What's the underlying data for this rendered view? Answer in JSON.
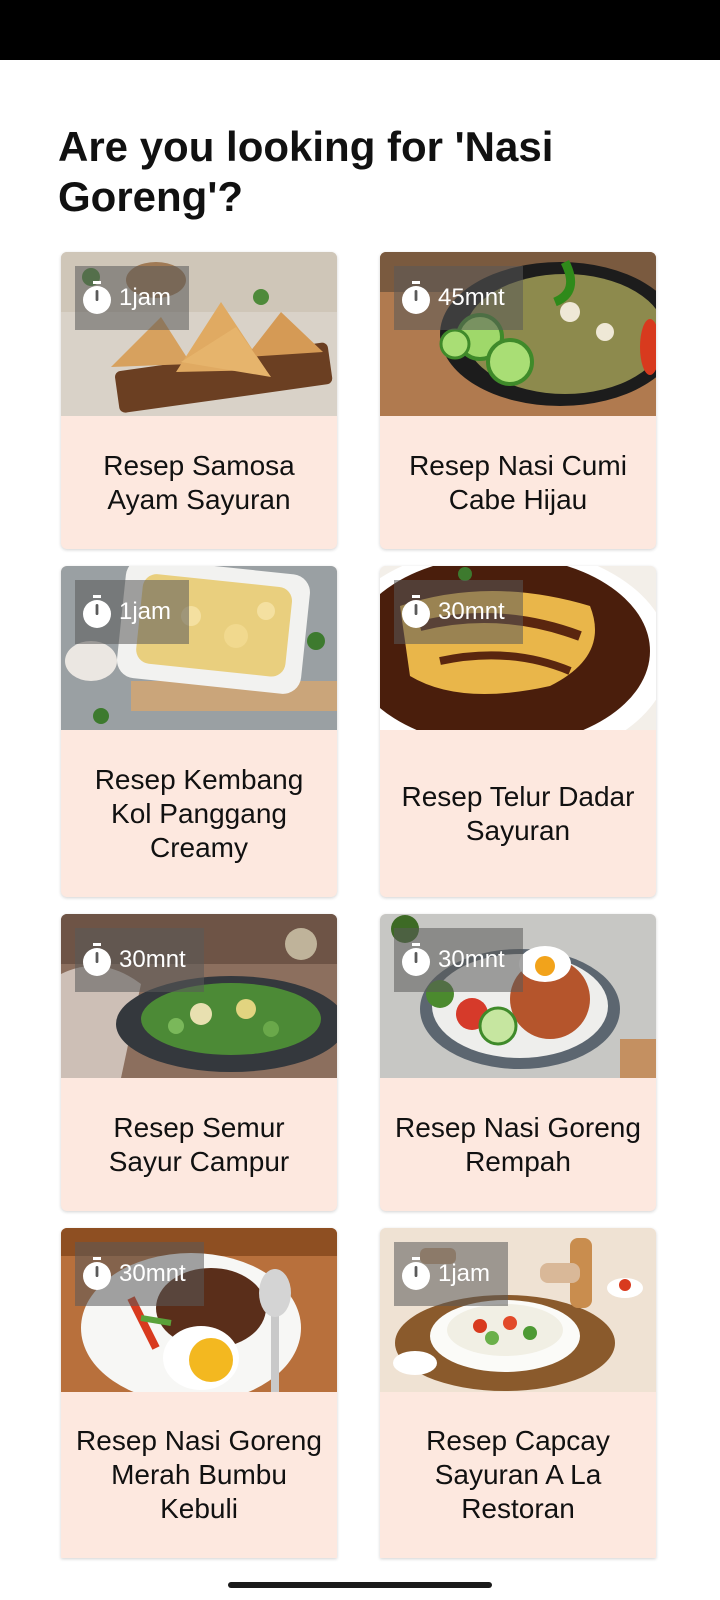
{
  "header": {
    "title": "Are you looking for 'Nasi Goreng'?"
  },
  "recipes": [
    {
      "title": "Resep Samosa Ayam Sayuran",
      "time": "1jam",
      "image": "samosa-photo"
    },
    {
      "title": "Resep Nasi Cumi Cabe Hijau",
      "time": "45mnt",
      "image": "nasi-cumi-photo"
    },
    {
      "title": "Resep Kembang Kol Panggang Creamy",
      "time": "1jam",
      "image": "baked-cauliflower-photo"
    },
    {
      "title": "Resep Telur Dadar Sayuran",
      "time": "30mnt",
      "image": "omelette-photo"
    },
    {
      "title": "Resep Semur Sayur Campur",
      "time": "30mnt",
      "image": "vegetable-stew-photo"
    },
    {
      "title": "Resep Nasi Goreng Rempah",
      "time": "30mnt",
      "image": "fried-rice-photo"
    },
    {
      "title": "Resep Nasi Goreng Merah Bumbu Kebuli",
      "time": "30mnt",
      "image": "red-fried-rice-photo"
    },
    {
      "title": "Resep Capcay Sayuran A La Restoran",
      "time": "1jam",
      "image": "capcay-photo"
    }
  ],
  "icons": {
    "timer": "stopwatch-icon"
  },
  "colors": {
    "card_background": "#fde8df",
    "status_bar": "#000000",
    "title_text": "#111111"
  }
}
